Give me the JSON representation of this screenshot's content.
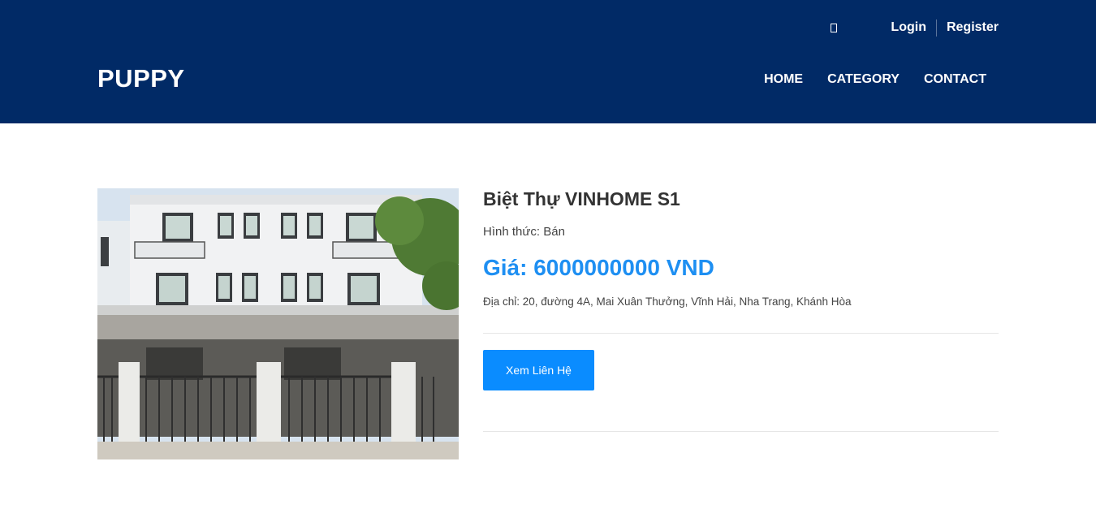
{
  "header": {
    "brand": "PUPPY",
    "topbar": {
      "login_label": "Login",
      "register_label": "Register",
      "glyph_icon": "missing-glyph-icon"
    },
    "nav": {
      "items": [
        {
          "label": "HOME"
        },
        {
          "label": "CATEGORY"
        },
        {
          "label": "CONTACT"
        }
      ]
    },
    "background_color": "#012a66"
  },
  "product": {
    "title": "Biệt Thự VINHOME S1",
    "form_label": "Hình thức: Bán",
    "price_label": "Giá: 6000000000 VND",
    "address_label": "Địa chỉ: 20, đường 4A, Mai Xuân Thưởng, Vĩnh Hải, Nha Trang, Khánh Hòa",
    "contact_button_label": "Xem Liên Hệ",
    "image_name": "villa-photo",
    "price_color": "#1e8ff2",
    "button_color": "#0a8cff"
  }
}
